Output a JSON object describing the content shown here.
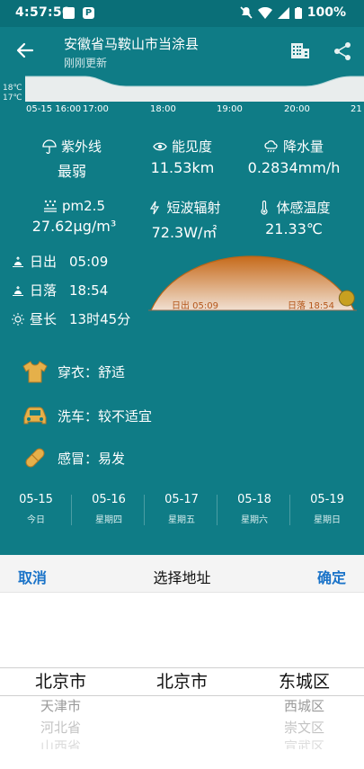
{
  "statusbar": {
    "time": "4:57:50",
    "battery": "100%"
  },
  "header": {
    "title": "安徽省马鞍山市当涂县",
    "subtitle": "刚刚更新"
  },
  "hourly": {
    "temp_labels": [
      "18℃",
      "17℃"
    ],
    "ticks": [
      "05-15 16:00",
      "17:00",
      "18:00",
      "19:00",
      "20:00",
      "21"
    ]
  },
  "metrics": [
    {
      "label": "紫外线",
      "value": "最弱",
      "icon": "umbrella-icon"
    },
    {
      "label": "能见度",
      "value": "11.53km",
      "icon": "eye-icon"
    },
    {
      "label": "降水量",
      "value": "0.2834mm/h",
      "icon": "cloud-rain-icon"
    },
    {
      "label": "pm2.5",
      "value": "27.62μg/m³",
      "icon": "dust-icon"
    },
    {
      "label": "短波辐射",
      "value": "72.3W/㎡",
      "icon": "shortwave-icon"
    },
    {
      "label": "体感温度",
      "value": "21.33℃",
      "icon": "thermometer-icon"
    }
  ],
  "sun": {
    "sunrise_label": "日出",
    "sunrise": "05:09",
    "sunset_label": "日落",
    "sunset": "18:54",
    "daylen_label": "昼长",
    "daylen": "13时45分",
    "curve_rise": "日出 05:09",
    "curve_set": "日落 18:54",
    "progress": 0.94
  },
  "tips": [
    {
      "text": "穿衣：舒适",
      "icon": "shirt-icon"
    },
    {
      "text": "洗车：较不适宜",
      "icon": "car-icon"
    },
    {
      "text": "感冒：易发",
      "icon": "pill-icon"
    }
  ],
  "days": [
    {
      "date": "05-15",
      "weekday": "今日"
    },
    {
      "date": "05-16",
      "weekday": "星期四"
    },
    {
      "date": "05-17",
      "weekday": "星期五"
    },
    {
      "date": "05-18",
      "weekday": "星期六"
    },
    {
      "date": "05-19",
      "weekday": "星期日"
    }
  ],
  "picker": {
    "cancel": "取消",
    "title": "选择地址",
    "confirm": "确定",
    "province": {
      "selected": "北京市",
      "options": [
        "天津市",
        "河北省",
        "山西省"
      ]
    },
    "city": {
      "selected": "北京市",
      "options": []
    },
    "district": {
      "selected": "东城区",
      "options": [
        "西城区",
        "崇文区",
        "宣武区"
      ]
    }
  },
  "colors": {
    "bg": "#0f7c86",
    "accent": "#1a73c8",
    "sun": "#c8a020"
  }
}
